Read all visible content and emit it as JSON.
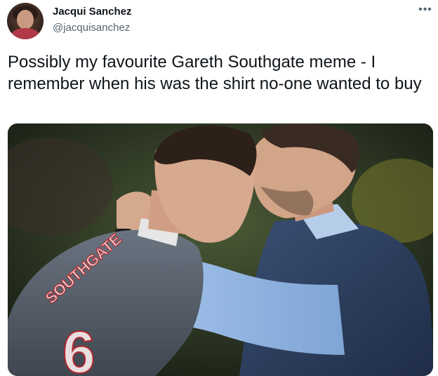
{
  "tweet": {
    "author": {
      "display_name": "Jacqui Sanchez",
      "handle": "@jacquisanchez"
    },
    "more_icon": "more-horizontal-icon",
    "text": "Possibly my favourite Gareth Southgate meme - I remember when his was the shirt no-one wanted to buy",
    "media": {
      "type": "photo",
      "shirt_lettering": "SOUTHGATE",
      "shirt_number": "6"
    }
  }
}
